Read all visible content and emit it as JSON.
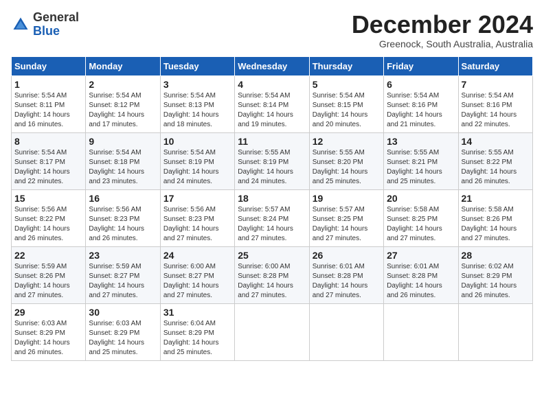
{
  "logo": {
    "general": "General",
    "blue": "Blue"
  },
  "title": "December 2024",
  "location": "Greenock, South Australia, Australia",
  "headers": [
    "Sunday",
    "Monday",
    "Tuesday",
    "Wednesday",
    "Thursday",
    "Friday",
    "Saturday"
  ],
  "weeks": [
    [
      {
        "day": "1",
        "sunrise": "5:54 AM",
        "sunset": "8:11 PM",
        "daylight": "14 hours and 16 minutes."
      },
      {
        "day": "2",
        "sunrise": "5:54 AM",
        "sunset": "8:12 PM",
        "daylight": "14 hours and 17 minutes."
      },
      {
        "day": "3",
        "sunrise": "5:54 AM",
        "sunset": "8:13 PM",
        "daylight": "14 hours and 18 minutes."
      },
      {
        "day": "4",
        "sunrise": "5:54 AM",
        "sunset": "8:14 PM",
        "daylight": "14 hours and 19 minutes."
      },
      {
        "day": "5",
        "sunrise": "5:54 AM",
        "sunset": "8:15 PM",
        "daylight": "14 hours and 20 minutes."
      },
      {
        "day": "6",
        "sunrise": "5:54 AM",
        "sunset": "8:16 PM",
        "daylight": "14 hours and 21 minutes."
      },
      {
        "day": "7",
        "sunrise": "5:54 AM",
        "sunset": "8:16 PM",
        "daylight": "14 hours and 22 minutes."
      }
    ],
    [
      {
        "day": "8",
        "sunrise": "5:54 AM",
        "sunset": "8:17 PM",
        "daylight": "14 hours and 22 minutes."
      },
      {
        "day": "9",
        "sunrise": "5:54 AM",
        "sunset": "8:18 PM",
        "daylight": "14 hours and 23 minutes."
      },
      {
        "day": "10",
        "sunrise": "5:54 AM",
        "sunset": "8:19 PM",
        "daylight": "14 hours and 24 minutes."
      },
      {
        "day": "11",
        "sunrise": "5:55 AM",
        "sunset": "8:19 PM",
        "daylight": "14 hours and 24 minutes."
      },
      {
        "day": "12",
        "sunrise": "5:55 AM",
        "sunset": "8:20 PM",
        "daylight": "14 hours and 25 minutes."
      },
      {
        "day": "13",
        "sunrise": "5:55 AM",
        "sunset": "8:21 PM",
        "daylight": "14 hours and 25 minutes."
      },
      {
        "day": "14",
        "sunrise": "5:55 AM",
        "sunset": "8:22 PM",
        "daylight": "14 hours and 26 minutes."
      }
    ],
    [
      {
        "day": "15",
        "sunrise": "5:56 AM",
        "sunset": "8:22 PM",
        "daylight": "14 hours and 26 minutes."
      },
      {
        "day": "16",
        "sunrise": "5:56 AM",
        "sunset": "8:23 PM",
        "daylight": "14 hours and 26 minutes."
      },
      {
        "day": "17",
        "sunrise": "5:56 AM",
        "sunset": "8:23 PM",
        "daylight": "14 hours and 27 minutes."
      },
      {
        "day": "18",
        "sunrise": "5:57 AM",
        "sunset": "8:24 PM",
        "daylight": "14 hours and 27 minutes."
      },
      {
        "day": "19",
        "sunrise": "5:57 AM",
        "sunset": "8:25 PM",
        "daylight": "14 hours and 27 minutes."
      },
      {
        "day": "20",
        "sunrise": "5:58 AM",
        "sunset": "8:25 PM",
        "daylight": "14 hours and 27 minutes."
      },
      {
        "day": "21",
        "sunrise": "5:58 AM",
        "sunset": "8:26 PM",
        "daylight": "14 hours and 27 minutes."
      }
    ],
    [
      {
        "day": "22",
        "sunrise": "5:59 AM",
        "sunset": "8:26 PM",
        "daylight": "14 hours and 27 minutes."
      },
      {
        "day": "23",
        "sunrise": "5:59 AM",
        "sunset": "8:27 PM",
        "daylight": "14 hours and 27 minutes."
      },
      {
        "day": "24",
        "sunrise": "6:00 AM",
        "sunset": "8:27 PM",
        "daylight": "14 hours and 27 minutes."
      },
      {
        "day": "25",
        "sunrise": "6:00 AM",
        "sunset": "8:28 PM",
        "daylight": "14 hours and 27 minutes."
      },
      {
        "day": "26",
        "sunrise": "6:01 AM",
        "sunset": "8:28 PM",
        "daylight": "14 hours and 27 minutes."
      },
      {
        "day": "27",
        "sunrise": "6:01 AM",
        "sunset": "8:28 PM",
        "daylight": "14 hours and 26 minutes."
      },
      {
        "day": "28",
        "sunrise": "6:02 AM",
        "sunset": "8:29 PM",
        "daylight": "14 hours and 26 minutes."
      }
    ],
    [
      {
        "day": "29",
        "sunrise": "6:03 AM",
        "sunset": "8:29 PM",
        "daylight": "14 hours and 26 minutes."
      },
      {
        "day": "30",
        "sunrise": "6:03 AM",
        "sunset": "8:29 PM",
        "daylight": "14 hours and 25 minutes."
      },
      {
        "day": "31",
        "sunrise": "6:04 AM",
        "sunset": "8:29 PM",
        "daylight": "14 hours and 25 minutes."
      },
      null,
      null,
      null,
      null
    ]
  ],
  "labels": {
    "sunrise": "Sunrise:",
    "sunset": "Sunset:",
    "daylight": "Daylight:"
  }
}
